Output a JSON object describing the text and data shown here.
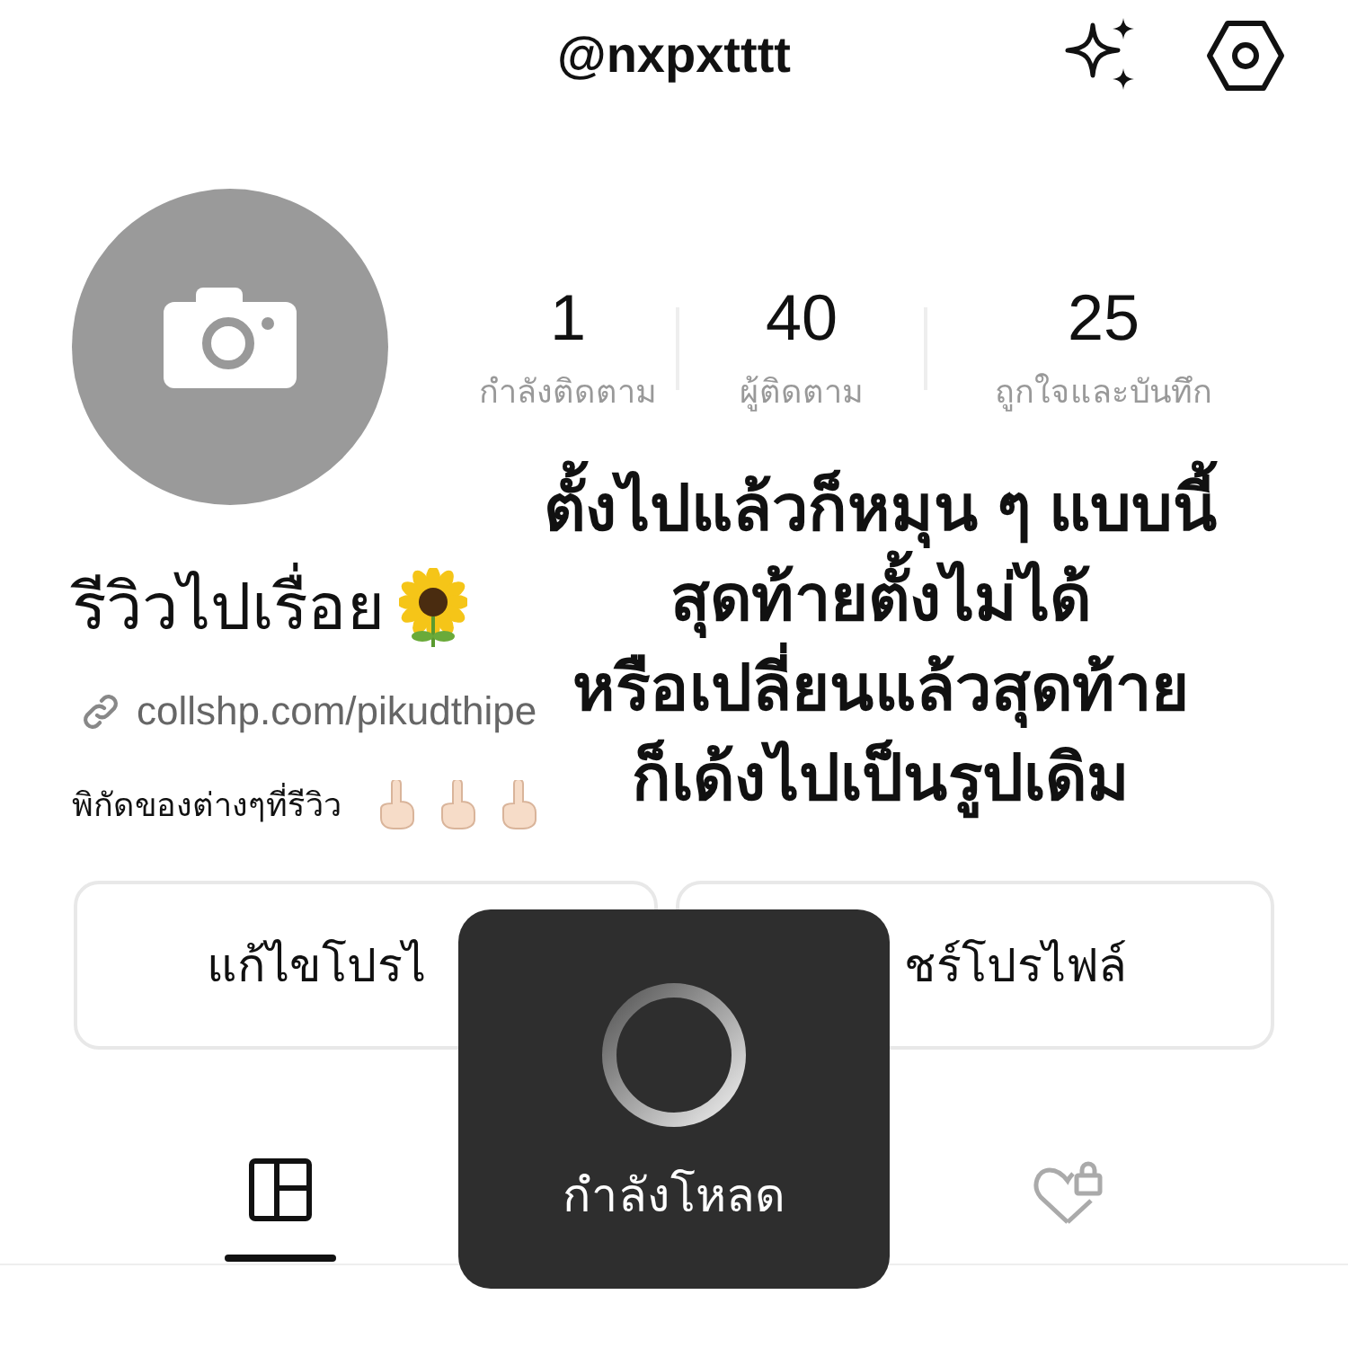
{
  "header": {
    "username": "@nxpxtttt"
  },
  "stats": [
    {
      "value": "1",
      "label": "กำลังติดตาม"
    },
    {
      "value": "40",
      "label": "ผู้ติดตาม"
    },
    {
      "value": "25",
      "label": "ถูกใจและบันทึก"
    }
  ],
  "profile": {
    "name": "รีวิวไปเรื่อย",
    "link": "collshp.com/pikudthipe",
    "bio": "พิกัดของต่างๆที่รีวิว"
  },
  "buttons": [
    "แก้ไขโปรไ",
    "ชร์โปรไฟล์"
  ],
  "tabs": [
    {
      "kind": "grid",
      "selected": true
    },
    {
      "kind": "liked",
      "selected": false
    }
  ],
  "caption": [
    "ตั้งไปแล้วก็หมุน ๆ แบบนี้",
    "สุดท้ายตั้งไม่ได้",
    "หรือเปลี่ยนแล้วสุดท้าย",
    "ก็เด้งไปเป็นรูปเดิม"
  ],
  "loading": {
    "text": "กำลังโหลด"
  }
}
